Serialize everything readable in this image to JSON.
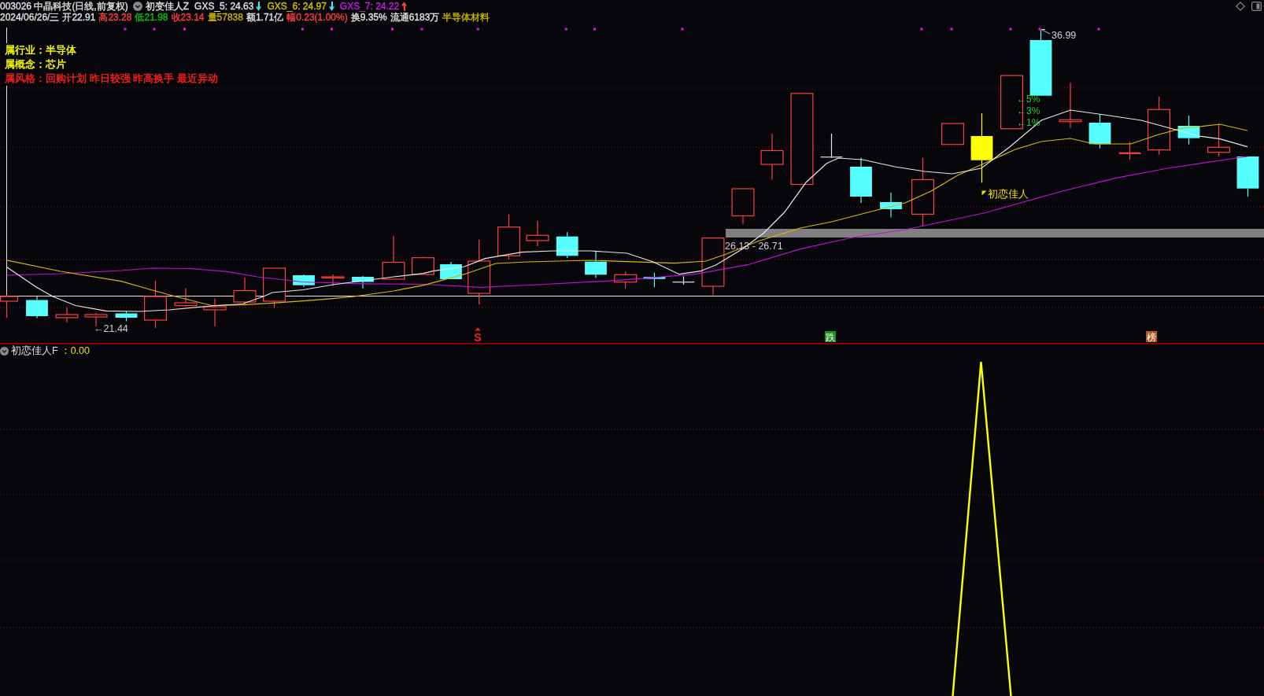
{
  "header": {
    "security": "003026 中晶科技(日线,前复权)",
    "indicator": "初变佳人Z",
    "series": [
      {
        "label": "GXS_5: 24.63",
        "color": "#e0e0e0",
        "arrow": {
          "kind": "down",
          "color": "#3ee6f0"
        }
      },
      {
        "label": "GXS_6: 24.97",
        "color": "#d8c000",
        "arrow": {
          "kind": "down",
          "color": "#3ee6f0"
        }
      },
      {
        "label": "GXS_7: 24.22",
        "color": "#c020e0",
        "arrow": {
          "kind": "up",
          "color": "#ff3b3b"
        }
      }
    ]
  },
  "quote": [
    {
      "text": "2024/06/26/三",
      "color": "#e0e0e0"
    },
    {
      "text": "开22.91",
      "color": "#e0e0e0"
    },
    {
      "text": "高23.28",
      "color": "#ff4040"
    },
    {
      "text": "低21.98",
      "color": "#10c010"
    },
    {
      "text": "收23.14",
      "color": "#ff4040"
    },
    {
      "text": "量57838",
      "color": "#c8b400"
    },
    {
      "text": "额1.71亿",
      "color": "#e0e0e0"
    },
    {
      "text": "幅0.23(1.00%)",
      "color": "#ff4040"
    },
    {
      "text": "换9.35%",
      "color": "#e0e0e0"
    },
    {
      "text": "流通6183万",
      "color": "#e0e0e0"
    },
    {
      "text": "半导体材料",
      "color": "#c8b400"
    }
  ],
  "tags": [
    {
      "label": "属行业：",
      "value": "半导体",
      "color": "#ffff00"
    },
    {
      "label": "属概念：",
      "value": "芯片",
      "color": "#ffff00"
    },
    {
      "label": "属风格：",
      "value": "回购计划 昨日较强 昨高换手 最近异动",
      "color": "#ff2020"
    }
  ],
  "chart": {
    "low_label": "←21.44",
    "high_label": "36.99",
    "range_label": "26.13 - 26.71",
    "percent_labels": [
      "←5%",
      "←3%",
      "←1%"
    ],
    "signal_label": "初恋佳人",
    "markers": [
      {
        "text": "S",
        "kind": "letter",
        "color": "#ff2020"
      },
      {
        "text": "跌",
        "kind": "badge",
        "color": "#1e8c1e"
      },
      {
        "text": "榜",
        "kind": "badge",
        "color": "#b0561e"
      }
    ]
  },
  "lower_panel": {
    "title": "初恋佳人F",
    "value": "：0.00"
  }
}
